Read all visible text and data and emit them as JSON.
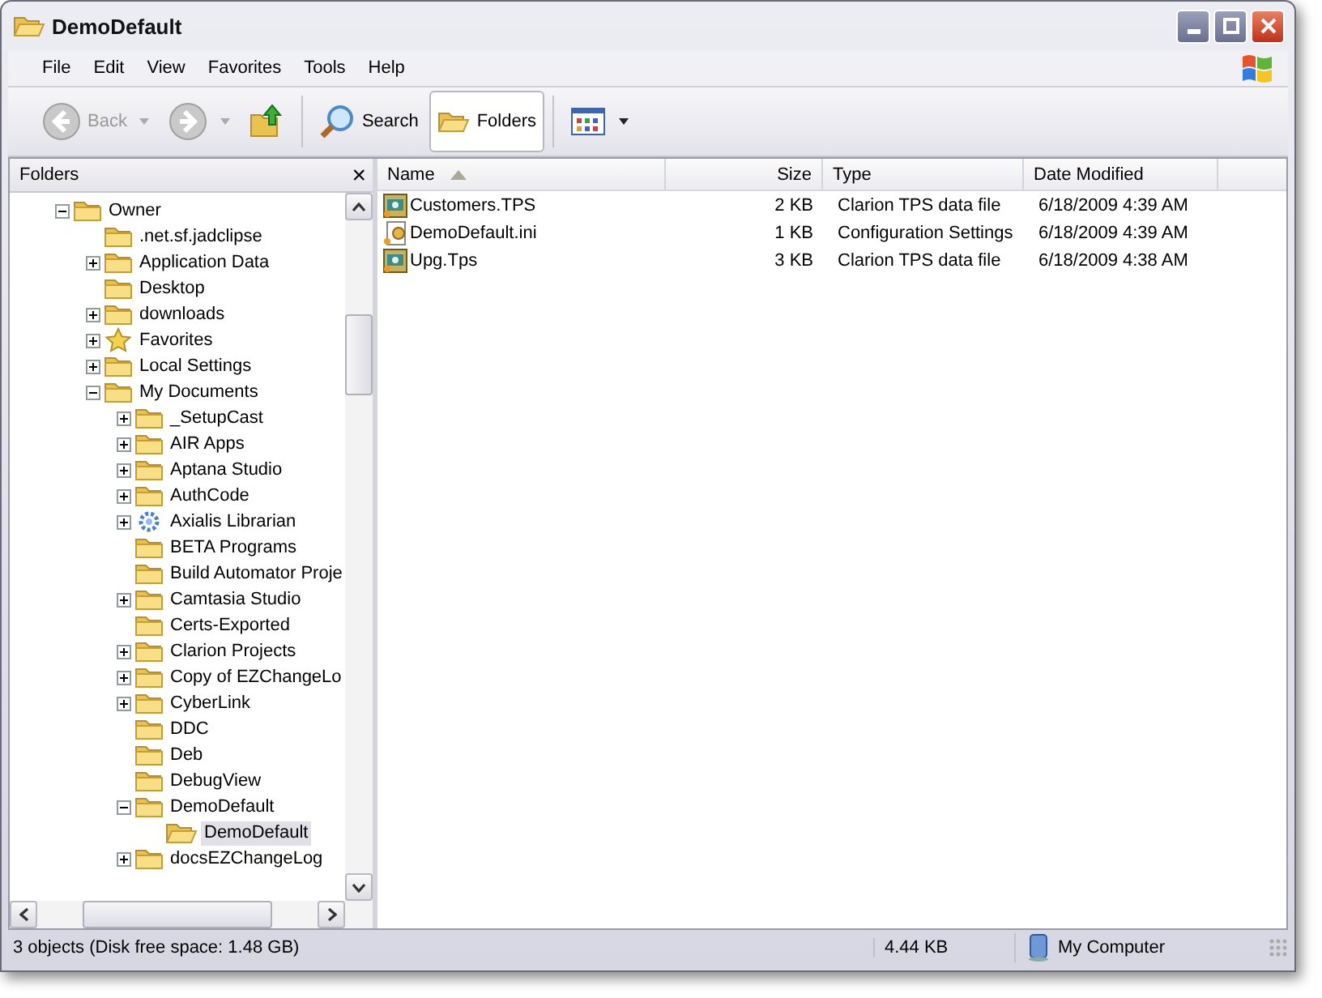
{
  "window": {
    "title": "DemoDefault"
  },
  "menu": [
    "File",
    "Edit",
    "View",
    "Favorites",
    "Tools",
    "Help"
  ],
  "toolbar": [
    {
      "kind": "back",
      "label": "Back",
      "disabled": true
    },
    {
      "kind": "forward",
      "disabled": true
    },
    {
      "kind": "up"
    },
    {
      "kind": "search",
      "label": "Search",
      "selected": false
    },
    {
      "kind": "folders",
      "label": "Folders",
      "selected": true
    },
    {
      "kind": "views"
    }
  ],
  "folders_pane": {
    "title": "Folders",
    "close": "×",
    "tree": [
      {
        "label": "Owner",
        "kind": "folder",
        "expanded": true,
        "selected": false,
        "children": [
          {
            "label": ".net.sf.jadclipse",
            "kind": "folder",
            "selected": false
          },
          {
            "label": "Application Data",
            "kind": "folder",
            "expanded": false,
            "selected": false
          },
          {
            "label": "Desktop",
            "kind": "folder",
            "selected": false
          },
          {
            "label": "downloads",
            "kind": "folder",
            "expanded": false,
            "selected": false
          },
          {
            "label": "Favorites",
            "kind": "star",
            "expanded": false,
            "selected": false
          },
          {
            "label": "Local Settings",
            "kind": "folder",
            "expanded": false,
            "selected": false
          },
          {
            "label": "My Documents",
            "kind": "folder",
            "expanded": true,
            "selected": false,
            "children": [
              {
                "label": "_SetupCast",
                "kind": "folder",
                "expanded": false,
                "selected": false
              },
              {
                "label": "AIR Apps",
                "kind": "folder",
                "expanded": false,
                "selected": false
              },
              {
                "label": "Aptana Studio",
                "kind": "folder",
                "expanded": false,
                "selected": false
              },
              {
                "label": "AuthCode",
                "kind": "folder",
                "expanded": false,
                "selected": false
              },
              {
                "label": "Axialis Librarian",
                "kind": "gears",
                "expanded": false,
                "selected": false
              },
              {
                "label": "BETA Programs",
                "kind": "folder",
                "selected": false
              },
              {
                "label": "Build Automator Proje",
                "kind": "folder",
                "selected": false
              },
              {
                "label": "Camtasia Studio",
                "kind": "folder",
                "expanded": false,
                "selected": false
              },
              {
                "label": "Certs-Exported",
                "kind": "folder",
                "selected": false
              },
              {
                "label": "Clarion Projects",
                "kind": "folder",
                "expanded": false,
                "selected": false
              },
              {
                "label": "Copy of EZChangeLo",
                "kind": "folder",
                "expanded": false,
                "selected": false
              },
              {
                "label": "CyberLink",
                "kind": "folder",
                "expanded": false,
                "selected": false
              },
              {
                "label": "DDC",
                "kind": "folder",
                "selected": false
              },
              {
                "label": "Deb",
                "kind": "folder",
                "selected": false
              },
              {
                "label": "DebugView",
                "kind": "folder",
                "selected": false
              },
              {
                "label": "DemoDefault",
                "kind": "folder",
                "expanded": true,
                "selected": false,
                "children": [
                  {
                    "label": "DemoDefault",
                    "kind": "folder",
                    "selected": true
                  }
                ]
              },
              {
                "label": "docsEZChangeLog",
                "kind": "folder",
                "expanded": false,
                "selected": false
              }
            ]
          }
        ]
      }
    ]
  },
  "file_list": {
    "columns": [
      {
        "label": "Name",
        "sorted": true
      },
      {
        "label": "Size",
        "sorted": false
      },
      {
        "label": "Type",
        "sorted": false
      },
      {
        "label": "Date Modified",
        "sorted": false
      }
    ],
    "rows": [
      {
        "kind": "tps",
        "name": "Customers.TPS",
        "size": "2 KB",
        "type": "Clarion TPS data file",
        "date_modified": "6/18/2009 4:39 AM"
      },
      {
        "kind": "ini",
        "name": "DemoDefault.ini",
        "size": "1 KB",
        "type": "Configuration Settings",
        "date_modified": "6/18/2009 4:39 AM"
      },
      {
        "kind": "tps",
        "name": "Upg.Tps",
        "size": "3 KB",
        "type": "Clarion TPS data file",
        "date_modified": "6/18/2009 4:38 AM"
      }
    ]
  },
  "status_bar": {
    "summary": "3 objects (Disk free space: 1.48 GB)",
    "size": "4.44 KB",
    "zone": "My Computer"
  }
}
